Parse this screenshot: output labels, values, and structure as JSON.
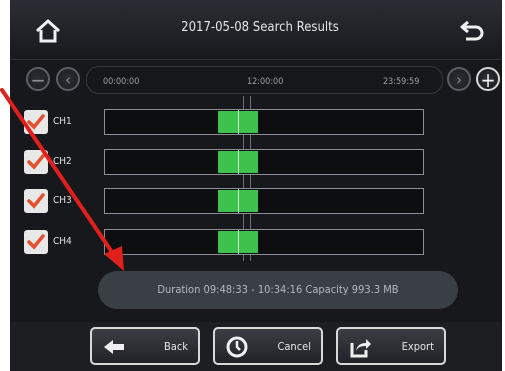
{
  "header": {
    "title": "2017-05-08 Search Results",
    "home_icon": "home-icon",
    "back_icon": "return-icon"
  },
  "timeline": {
    "ticks": [
      "00:00:00",
      "12:00:00",
      "23:59:59"
    ],
    "zoom_out_icon": "minus-icon",
    "zoom_in_icon": "plus-icon",
    "prev_icon": "chevron-left-icon",
    "next_icon": "chevron-right-icon"
  },
  "channels": [
    {
      "label": "CH1",
      "checked": true
    },
    {
      "label": "CH2",
      "checked": true
    },
    {
      "label": "CH3",
      "checked": true
    },
    {
      "label": "CH4",
      "checked": true
    }
  ],
  "recording": {
    "start": "09:48:33",
    "end": "10:34:16"
  },
  "info": {
    "text": "Duration 09:48:33 - 10:34:16  Capacity 993.3 MB"
  },
  "buttons": {
    "back": "Back",
    "cancel": "Cancel",
    "export": "Export"
  },
  "colors": {
    "segment": "#3fc24d",
    "annotation_arrow": "#e0201c"
  }
}
